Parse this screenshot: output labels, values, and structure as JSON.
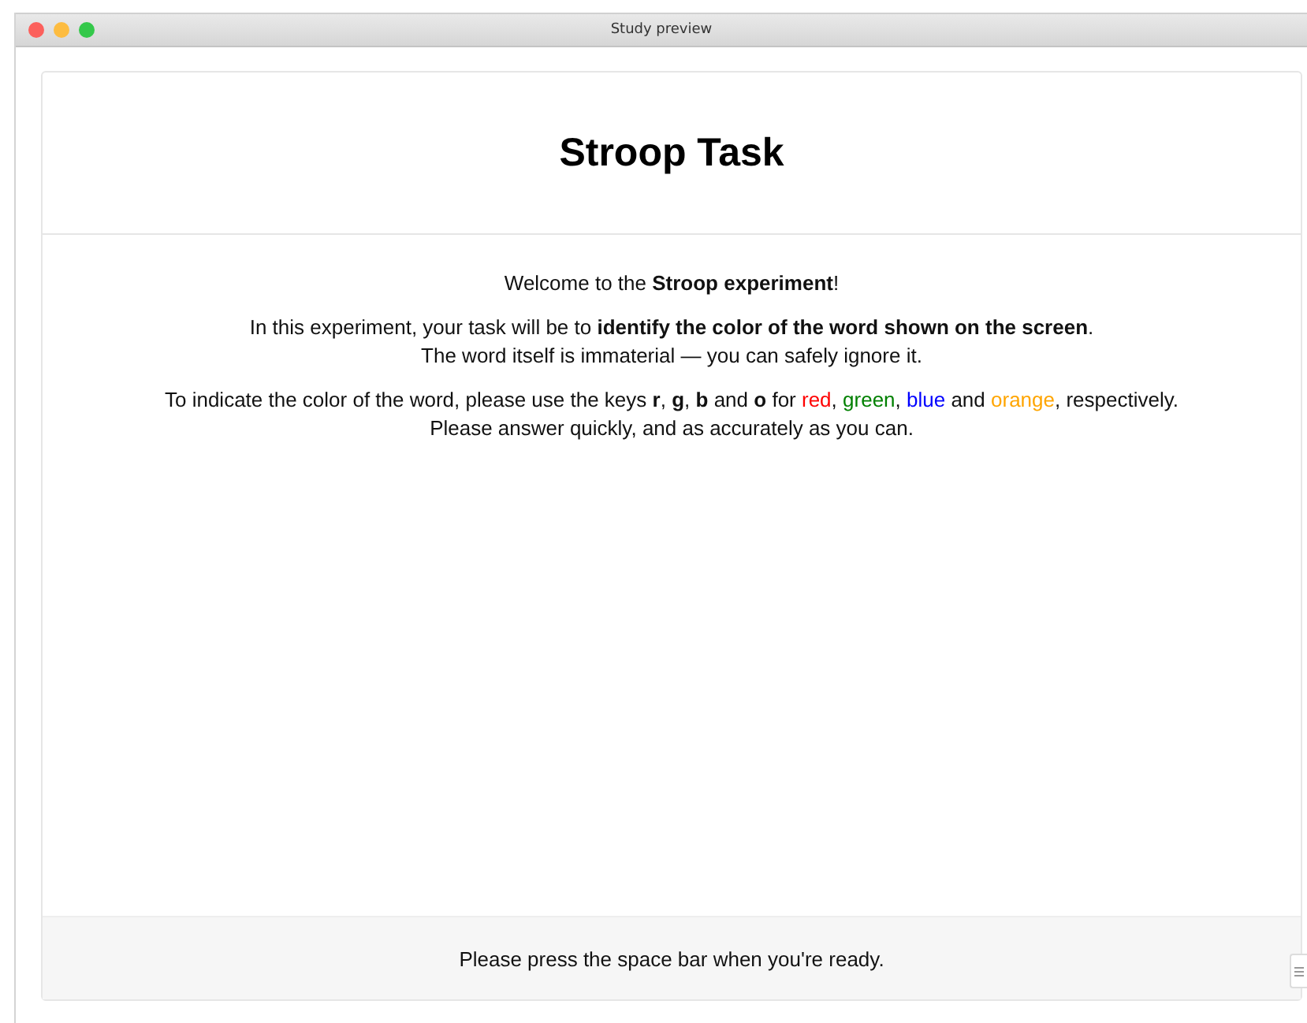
{
  "window": {
    "title": "Study preview"
  },
  "heading": "Stroop Task",
  "paragraphs": [
    {
      "lines": [
        [
          {
            "text": "Welcome to the **Stroop experiment**!"
          }
        ]
      ]
    },
    {
      "lines": [
        [
          {
            "text": "In this experiment, your task will be to **identify the color of the word shown on the screen**."
          }
        ],
        [
          {
            "text": "The word itself is immaterial — you can safely ignore it."
          }
        ]
      ]
    },
    {
      "lines": [
        [
          {
            "text": "To indicate the color of the word, please use the keys **r**, **g**, **b** and **o** for "
          },
          {
            "text": "red",
            "color": "#ff0000"
          },
          {
            "text": ", "
          },
          {
            "text": "green",
            "color": "#008000"
          },
          {
            "text": ", "
          },
          {
            "text": "blue",
            "color": "#0000ff"
          },
          {
            "text": " and "
          },
          {
            "text": "orange",
            "color": "#ffa500"
          },
          {
            "text": ", respectively."
          }
        ],
        [
          {
            "text": "Please answer quickly, and as accurately as you can."
          }
        ]
      ]
    }
  ],
  "footer": "Please press the space bar when you're ready."
}
